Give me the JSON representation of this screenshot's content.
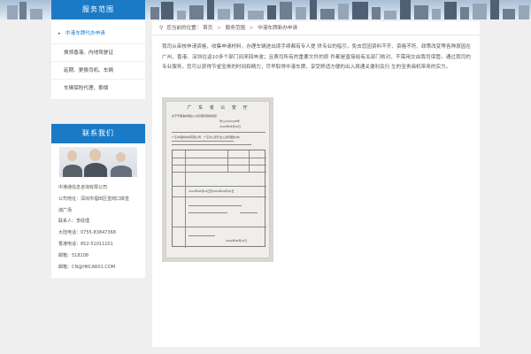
{
  "sidebar": {
    "service_title": "服务范围",
    "menu": [
      {
        "label": "中港车牌代办申请",
        "active": true
      },
      {
        "label": "换领香港、内地驾驶证"
      },
      {
        "label": "延期、更换司机、车辆"
      },
      {
        "label": "车辆保险代理、索偿"
      }
    ],
    "contact_title": "联系我们",
    "contact_lines": [
      "中港通信息咨询有限公司",
      "公司地址：深圳市福田区皇岗口岸皇",
      "城广场",
      "联系人：李经理",
      "大陆电话：0755-83847368",
      "香港电话：852-51011101",
      "邮箱：518108",
      "邮箱：CN@HKCAR01.COM"
    ]
  },
  "breadcrumb": {
    "prefix": "您当前的位置：",
    "items": [
      "首页",
      "服务范围",
      "中港车牌新办申请"
    ]
  },
  "main": {
    "intro": "我司从审核申请资格，收集申请材料，办理车辆进出境手续都有专人提 供专业的指引，免去您因资料不齐、资格不符、政策改变等各种原因在广州、香港、深圳往返10多个部门间来回奔波；且费司所有的重要文件的原 件都是直接给有关部门核对，不需用交由我司保管。通过我司的专业服务，您可以获得节省宝贵的时间和精力，尽早取得中港车牌，享受舒适方便的出入境通关便利及衍 生的宝贵商机带来的实力。",
    "document": {
      "title": "广 东 省 公 安 厅",
      "subject": "关于粤港澳车辆出入境管理问题的批复",
      "number": "粤公[2002]46号",
      "date_1": "2002年08月22日",
      "addressee": "广东中港通车务有限公司：广东省公安厅出入境管理处(中)",
      "table_date": "2003年08月01日至2004年08月01日",
      "footer_date": "2002年08月22日"
    }
  },
  "colors": {
    "accent": "#1b7ac6",
    "page_bg": "#efefef"
  }
}
